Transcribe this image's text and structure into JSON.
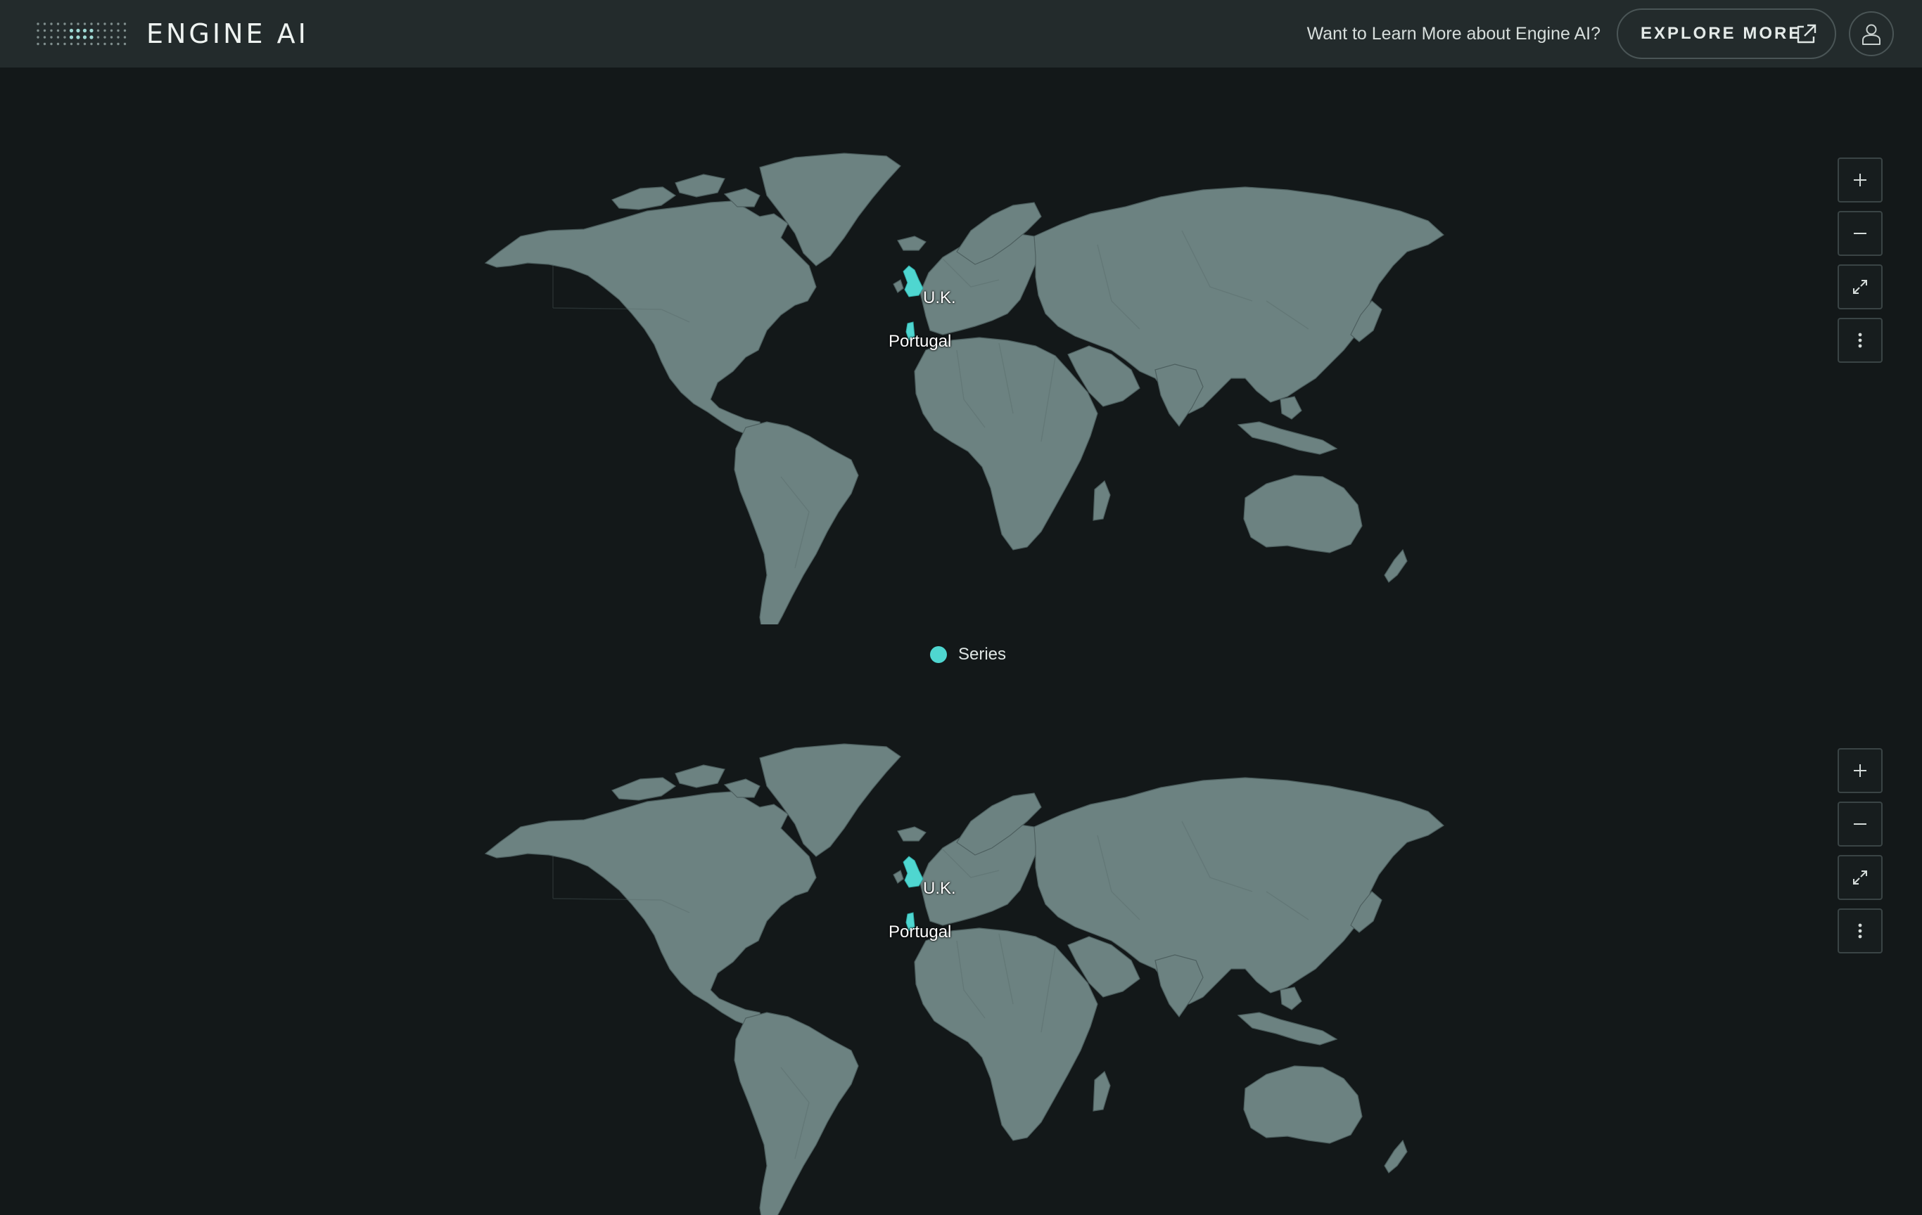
{
  "header": {
    "brand": "ENGINE AI",
    "learn_more_text": "Want to Learn More about Engine AI?",
    "explore_label": "EXPLORE MORE",
    "logo_icon": "dot-grid-logo",
    "explore_icon": "external-link-icon",
    "user_icon": "user-icon"
  },
  "colors": {
    "background": "#131819",
    "header": "#232b2c",
    "land": "#6c8281",
    "highlight": "#4fd6d0"
  },
  "maps": [
    {
      "labels": {
        "uk": "U.K.",
        "portugal": "Portugal"
      },
      "legend": {
        "label": "Series"
      },
      "controls": [
        "zoom-in",
        "zoom-out",
        "fullscreen",
        "more"
      ]
    },
    {
      "labels": {
        "uk": "U.K.",
        "portugal": "Portugal"
      },
      "controls": [
        "zoom-in",
        "zoom-out",
        "fullscreen",
        "more"
      ]
    }
  ]
}
